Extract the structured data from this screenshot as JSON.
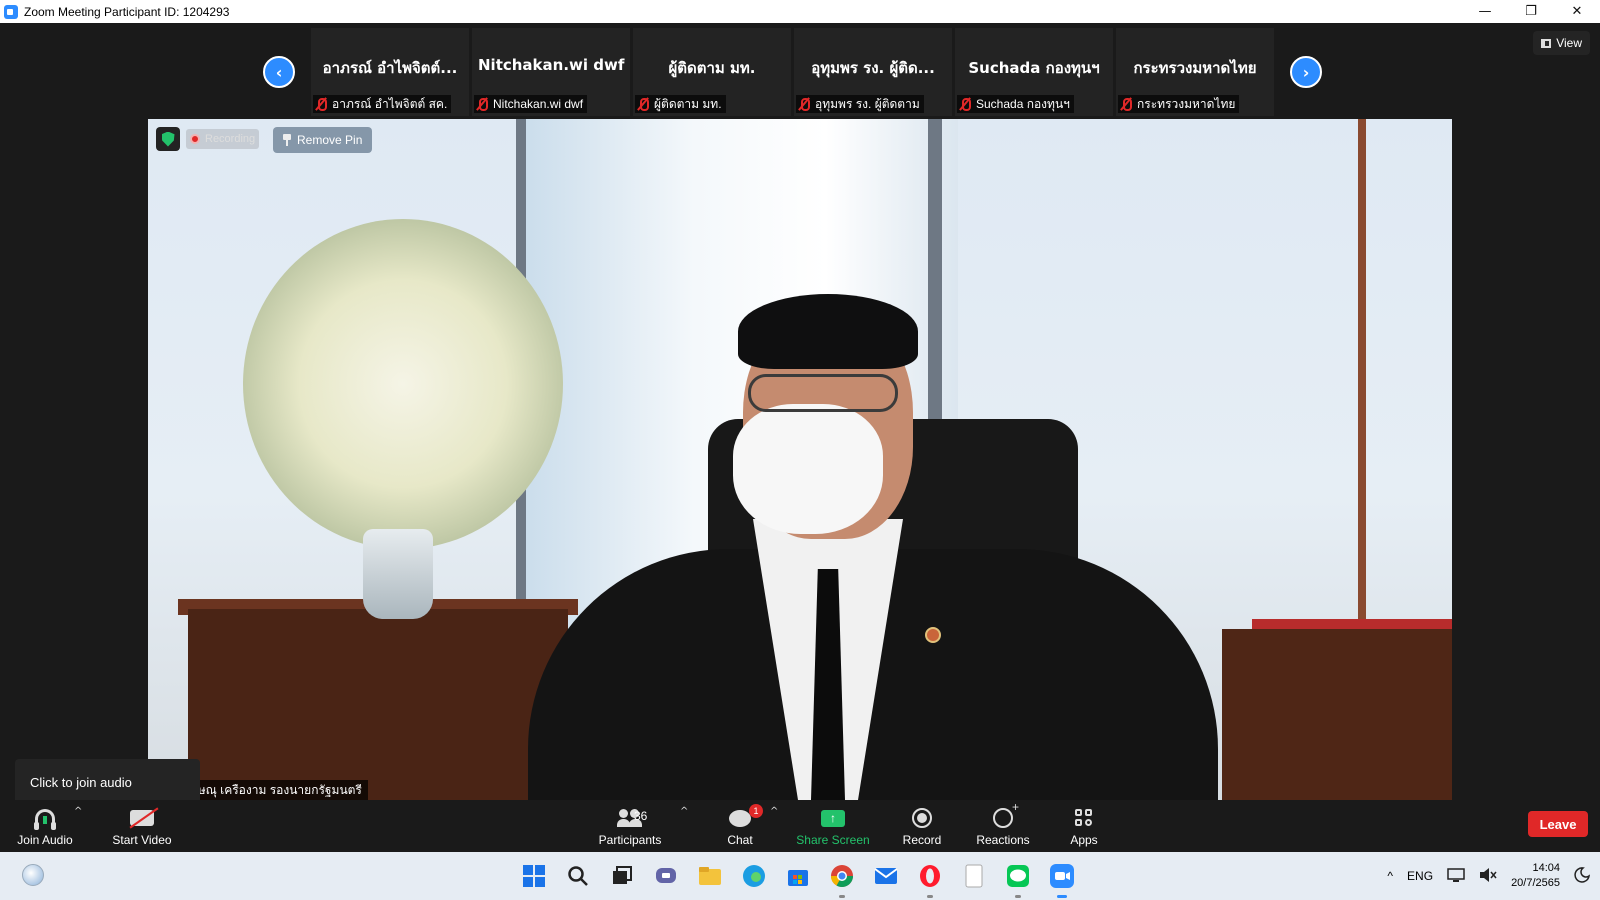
{
  "window": {
    "title": "Zoom Meeting Participant ID: 1204293",
    "controls": {
      "minimize": "—",
      "restore": "❐",
      "close": "✕"
    }
  },
  "view_button": {
    "label": "View",
    "icon": "grid-icon"
  },
  "gallery": {
    "prev_icon": "chevron-left-icon",
    "next_icon": "chevron-right-icon",
    "tiles": [
      {
        "name": "อาภรณ์ อำไพจิตต์...",
        "label": "อาภรณ์ อำไพจิตต์ สค.",
        "muted": true
      },
      {
        "name": "Nitchakan.wi dwf",
        "label": "Nitchakan.wi dwf",
        "muted": true
      },
      {
        "name": "ผู้ติดตาม มท.",
        "label": "ผู้ติดตาม มท.",
        "muted": true
      },
      {
        "name": "อุทุมพร รง. ผู้ติด...",
        "label": "อุทุมพร รง. ผู้ติดตาม",
        "muted": true
      },
      {
        "name": "Suchada กองทุนฯ",
        "label": "Suchada กองทุนฯ",
        "muted": true
      },
      {
        "name": "กระทรวงมหาดไทย",
        "label": "กระทรวงมหาดไทย",
        "muted": true
      }
    ]
  },
  "main_video": {
    "recording_label": "Recording",
    "remove_pin_label": "Remove Pin",
    "speaker_name": "นายวิษณุ เครืองาม รองนายกรัฐมนตรี"
  },
  "tooltip": {
    "text": "Click to join audio"
  },
  "toolbar": {
    "join_audio": "Join Audio",
    "start_video": "Start Video",
    "participants": "Participants",
    "participants_count": "36",
    "chat": "Chat",
    "chat_badge": "1",
    "share_screen": "Share Screen",
    "record": "Record",
    "reactions": "Reactions",
    "apps": "Apps",
    "leave": "Leave",
    "caret": "^"
  },
  "colors": {
    "accent": "#2d8cff",
    "danger": "#e02828",
    "share_green": "#23c26b",
    "background": "#1a1a1a"
  },
  "taskbar": {
    "apps": [
      "windows-start-icon",
      "search-icon",
      "task-view-icon",
      "teams-chat-icon",
      "file-explorer-icon",
      "edge-icon",
      "microsoft-store-icon",
      "chrome-icon",
      "mail-icon",
      "opera-icon",
      "notepad-icon",
      "line-icon",
      "zoom-icon"
    ],
    "language": "ENG",
    "time": "14:04",
    "date": "20/7/2565",
    "tray_caret": "^"
  }
}
